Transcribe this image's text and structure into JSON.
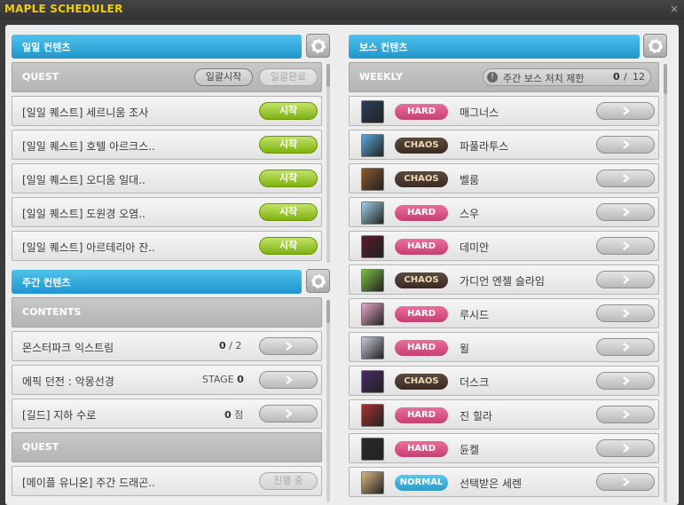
{
  "window": {
    "title": "MAPLE SCHEDULER",
    "close": "×"
  },
  "daily": {
    "header": "일일 컨텐츠",
    "section": "QUEST",
    "bulk_start": "일괄시작",
    "bulk_done": "일괄완료",
    "start_label": "시작",
    "quests": [
      "[일일 퀘스트] 세르니움 조사",
      "[일일 퀘스트] 호텔 아르크스..",
      "[일일 퀘스트] 오디움 일대..",
      "[일일 퀘스트] 도원경 오염..",
      "[일일 퀘스트] 아르테리아 잔.."
    ]
  },
  "weekly_contents": {
    "header": "주간 컨텐츠",
    "contents_title": "CONTENTS",
    "monster_park": {
      "label": "몬스터파크 익스트림",
      "done": "0",
      "sep": "/",
      "total": "2"
    },
    "epic_dungeon": {
      "label": "에픽 던전 : 악몽선경",
      "stage_label": "STAGE",
      "stage": "0"
    },
    "guild": {
      "label": "[길드] 지하 수로",
      "value": "0",
      "unit": "점"
    },
    "quest_title": "QUEST",
    "union": {
      "label": "[메이플 유니온] 주간 드래곤..",
      "status": "진행 중"
    }
  },
  "boss": {
    "header": "보스 컨텐츠",
    "weekly_title": "WEEKLY",
    "limit_icon": "!",
    "limit_label": "주간 보스 처치 제한",
    "limit_done": "0",
    "limit_sep": "/",
    "limit_total": "12",
    "bosses": [
      {
        "difficulty": "HARD",
        "name": "매그너스",
        "icon_color": "#2b3e5a"
      },
      {
        "difficulty": "CHAOS",
        "name": "파풀라투스",
        "icon_color": "#5aa7d8"
      },
      {
        "difficulty": "CHAOS",
        "name": "벨룸",
        "icon_color": "#8a5a2a"
      },
      {
        "difficulty": "HARD",
        "name": "스우",
        "icon_color": "#9fd0e8"
      },
      {
        "difficulty": "HARD",
        "name": "데미안",
        "icon_color": "#5a1a2a"
      },
      {
        "difficulty": "CHAOS",
        "name": "가디언 엔젤 슬라임",
        "icon_color": "#7ac040"
      },
      {
        "difficulty": "HARD",
        "name": "루시드",
        "icon_color": "#e8a8c8"
      },
      {
        "difficulty": "HARD",
        "name": "윌",
        "icon_color": "#c8c8d8"
      },
      {
        "difficulty": "CHAOS",
        "name": "더스크",
        "icon_color": "#4a2a6a"
      },
      {
        "difficulty": "HARD",
        "name": "진 힐라",
        "icon_color": "#a83030"
      },
      {
        "difficulty": "HARD",
        "name": "듄켈",
        "icon_color": "#2a2a2a"
      },
      {
        "difficulty": "NORMAL",
        "name": "선택받은 세렌",
        "icon_color": "#d8b880"
      }
    ]
  }
}
